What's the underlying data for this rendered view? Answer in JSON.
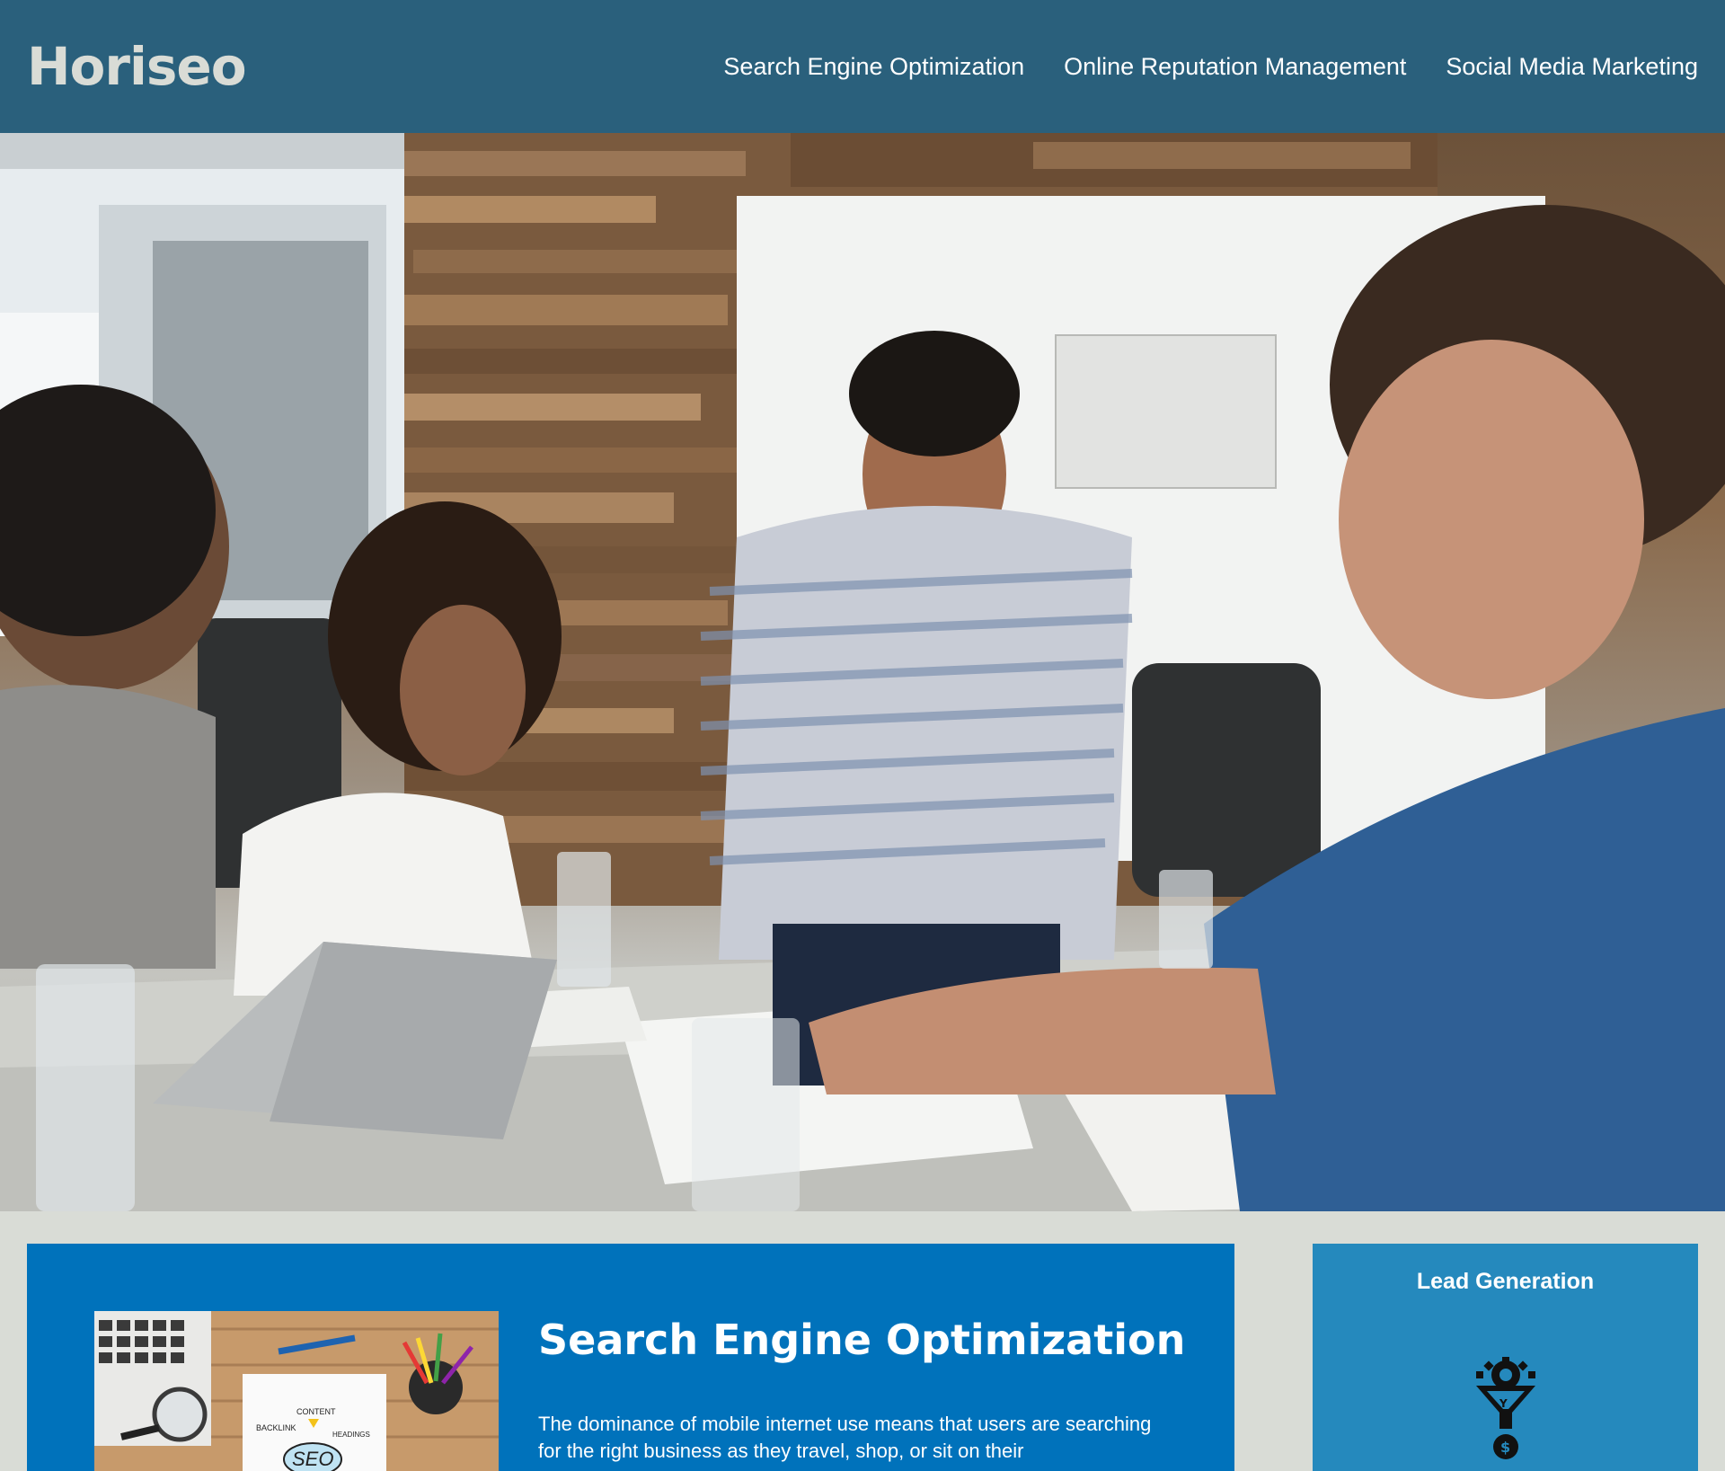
{
  "header": {
    "brand": "Horiseo",
    "nav": [
      {
        "label": "Search Engine Optimization"
      },
      {
        "label": "Online Reputation Management"
      },
      {
        "label": "Social Media Marketing"
      }
    ]
  },
  "hero": {
    "image": "team-meeting-photo"
  },
  "main": {
    "section": {
      "title": "Search Engine Optimization",
      "body": "The dominance of mobile internet use means that users are searching for the right business as they travel, shop, or sit on their",
      "image": "seo-illustration",
      "image_labels": [
        "CONTENT",
        "BACKLINK",
        "HEADINGS",
        "SEO"
      ]
    }
  },
  "sidebar": {
    "title": "Lead Generation",
    "icon": "lead-generation-funnel-icon"
  },
  "colors": {
    "header_bg": "#2a607c",
    "brand": "#d9dcd6",
    "page_bg": "#d9dcd6",
    "content_bg": "#0072bb",
    "sidebar_bg": "#2589bd"
  }
}
